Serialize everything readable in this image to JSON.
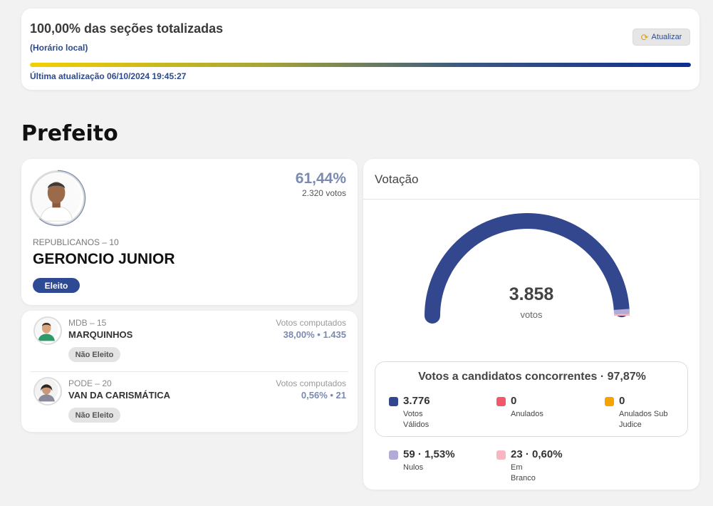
{
  "totalization": {
    "title": "100,00% das seções totalizadas",
    "subtitle": "(Horário local)",
    "refresh_label": "Atualizar",
    "refresh_icon": "refresh-icon",
    "progress": 1.0,
    "last_update": "Última atualização 06/10/2024 19:45:27"
  },
  "section_title": "Prefeito",
  "winner": {
    "percent": "61,44%",
    "votes": "2.320 votos",
    "party": "REPUBLICANOS – 10",
    "name": "GERONCIO JUNIOR",
    "status": "Eleito",
    "status_color": "#2f4a95"
  },
  "others": [
    {
      "party": "MDB – 15",
      "name": "MARQUINHOS",
      "status": "Não Eleito",
      "votes_label": "Votos computados",
      "stats": "38,00%  •  1.435"
    },
    {
      "party": "PODE – 20",
      "name": "VAN DA CARISMÁTICA",
      "status": "Não Eleito",
      "votes_label": "Votos computados",
      "stats": "0,56%  •  21"
    }
  ],
  "voting": {
    "title": "Votação",
    "total": "3.858",
    "total_label": "votos",
    "concurrent_title": "Votos a candidatos concorrentes · 97,87%",
    "stats": {
      "validos": {
        "value": "3.776",
        "label": "Votos Válidos",
        "color": "#33478f"
      },
      "anulados": {
        "value": "0",
        "label": "Anulados",
        "color": "#f0596a"
      },
      "sub_judice": {
        "value": "0",
        "label": "Anulados Sub Judice",
        "color": "#f4a300"
      },
      "nulos": {
        "value": "59 · 1,53%",
        "label": "Nulos",
        "color": "#b1acd6"
      },
      "branco": {
        "value": "23 · 0,60%",
        "label": "Em Branco",
        "color": "#f7b6c2"
      }
    },
    "gauge": {
      "valid_fraction": 0.9787,
      "nulos_fraction": 0.0153,
      "branco_fraction": 0.006
    }
  }
}
